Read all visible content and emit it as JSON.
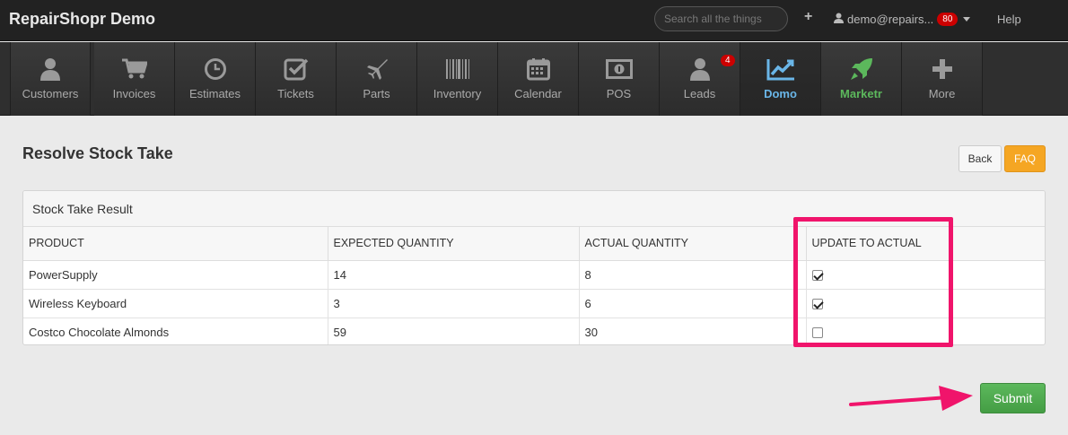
{
  "app": {
    "brand": "RepairShopr Demo",
    "search_placeholder": "Search all the things",
    "add": "+",
    "user": "demo@repairs...",
    "notifications": "80",
    "help": "Help"
  },
  "nav": [
    {
      "label": "Customers",
      "icon": "user-icon"
    },
    {
      "label": "Invoices",
      "icon": "cart-icon"
    },
    {
      "label": "Estimates",
      "icon": "clock-icon"
    },
    {
      "label": "Tickets",
      "icon": "checkbox-icon"
    },
    {
      "label": "Parts",
      "icon": "plane-icon"
    },
    {
      "label": "Inventory",
      "icon": "barcode-icon"
    },
    {
      "label": "Calendar",
      "icon": "calendar-icon"
    },
    {
      "label": "POS",
      "icon": "money-icon"
    },
    {
      "label": "Leads",
      "icon": "user-icon",
      "badge": "4"
    },
    {
      "label": "Domo",
      "icon": "chart-icon"
    },
    {
      "label": "Marketr",
      "icon": "rocket-icon"
    },
    {
      "label": "More",
      "icon": "plus-icon"
    }
  ],
  "page": {
    "title": "Resolve Stock Take",
    "back": "Back",
    "faq": "FAQ",
    "panel_title": "Stock Take Result",
    "columns": [
      "PRODUCT",
      "EXPECTED QUANTITY",
      "ACTUAL QUANTITY",
      "UPDATE TO ACTUAL"
    ],
    "rows": [
      {
        "product": "PowerSupply",
        "expected": "14",
        "actual": "8",
        "update": true
      },
      {
        "product": "Wireless Keyboard",
        "expected": "3",
        "actual": "6",
        "update": true
      },
      {
        "product": "Costco Chocolate Almonds",
        "expected": "59",
        "actual": "30",
        "update": false
      }
    ],
    "submit": "Submit"
  },
  "colors": {
    "highlight": "#f0146b",
    "submit": "#5cb85c",
    "faq": "#f5a623",
    "domo": "#6ab6e8",
    "marketr": "#5cb85c"
  }
}
